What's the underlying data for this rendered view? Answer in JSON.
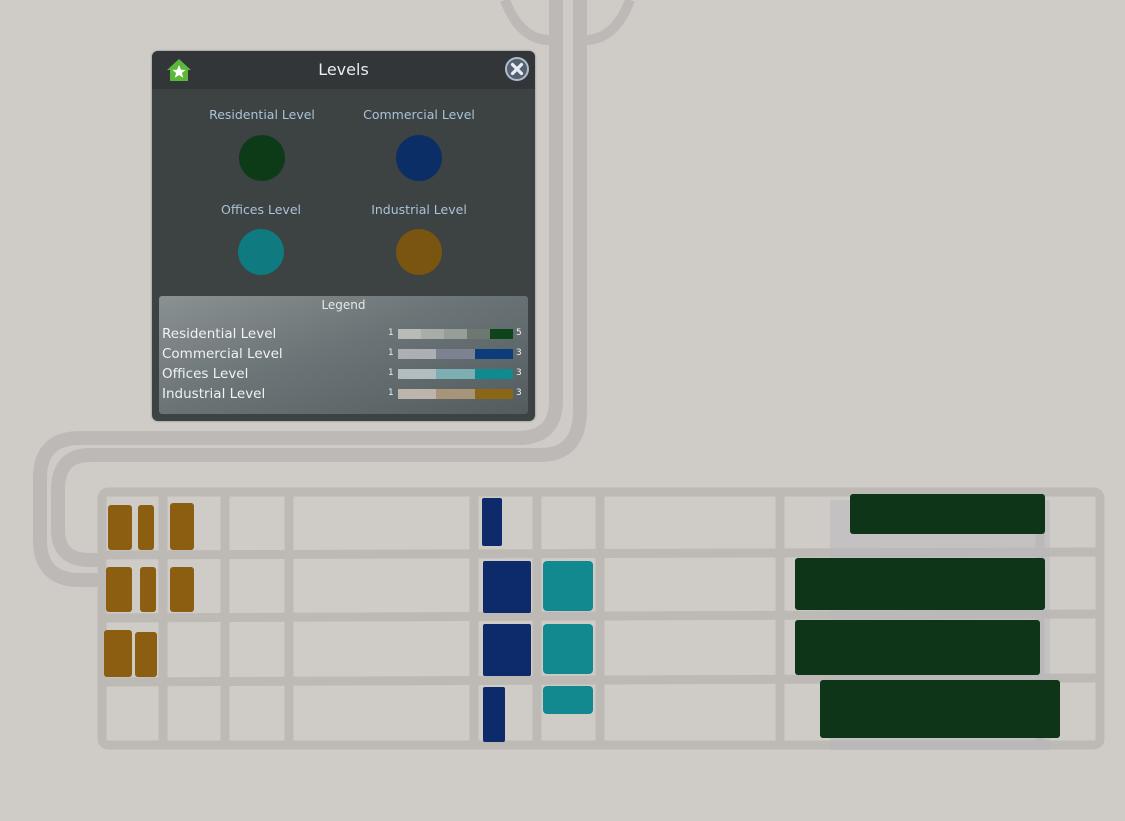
{
  "panel": {
    "title": "Levels",
    "home_icon": "home-star-icon",
    "close_icon": "close-x-icon",
    "categories": [
      {
        "label": "Residential Level",
        "color": "#0d3a17"
      },
      {
        "label": "Commercial Level",
        "color": "#0b2e66"
      },
      {
        "label": "Offices Level",
        "color": "#0f7a80"
      },
      {
        "label": "Industrial Level",
        "color": "#7a5510"
      }
    ],
    "legend": {
      "title": "Legend",
      "rows": [
        {
          "label": "Residential Level",
          "min": "1",
          "max": "5",
          "colors": [
            "#b9bbb8",
            "#a8ada9",
            "#979e99",
            "#6c7870",
            "#0e4419"
          ]
        },
        {
          "label": "Commercial Level",
          "min": "1",
          "max": "3",
          "colors": [
            "#acb0b4",
            "#7c8291",
            "#0c3d7a"
          ]
        },
        {
          "label": "Offices Level",
          "min": "1",
          "max": "3",
          "colors": [
            "#b2bdbf",
            "#7caeb3",
            "#0f8a91"
          ]
        },
        {
          "label": "Industrial Level",
          "min": "1",
          "max": "3",
          "colors": [
            "#bdb4ac",
            "#a89478",
            "#8a6615"
          ]
        }
      ]
    }
  }
}
